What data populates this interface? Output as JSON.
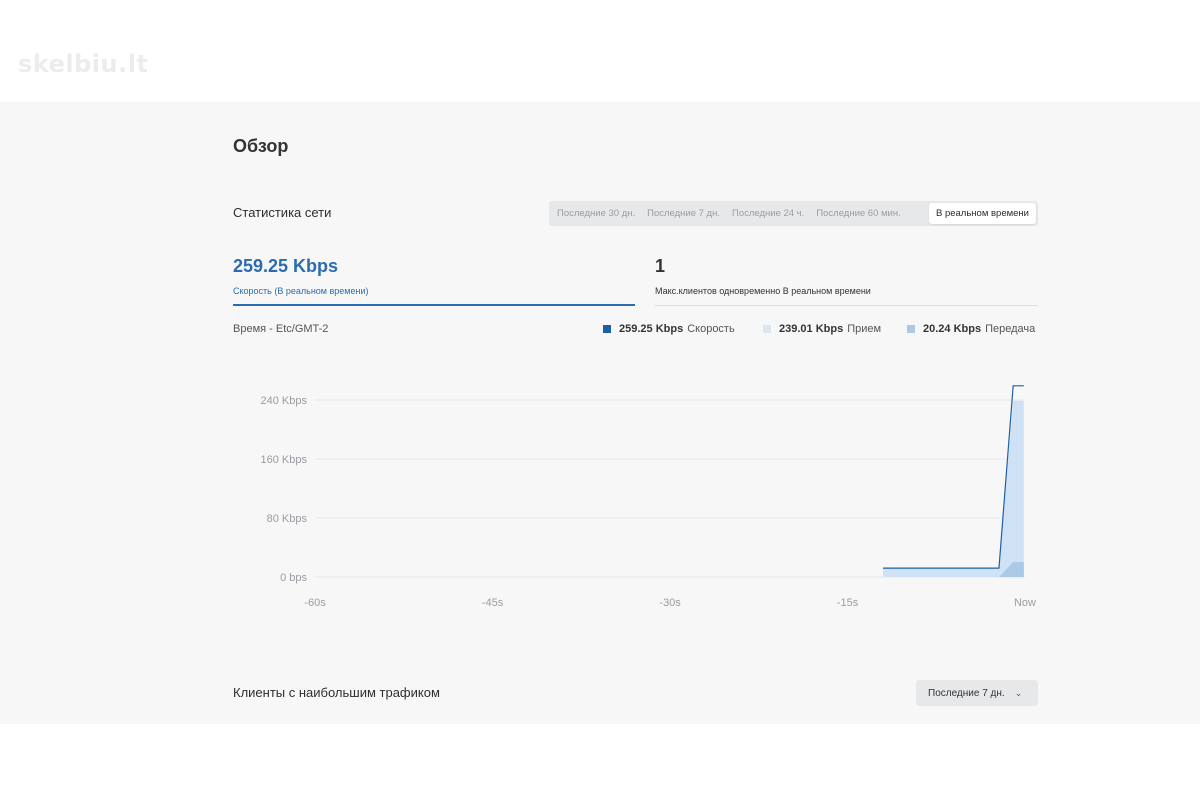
{
  "watermark": "skelbiu.lt",
  "page_title": "Обзор",
  "network": {
    "title": "Статистика сети",
    "ranges": [
      "Последние 30 дн.",
      "Последние 7 дн.",
      "Последние 24 ч.",
      "Последние 60 мин."
    ],
    "active_range": "В реальном времени",
    "speed_value": "259.25 Kbps",
    "speed_label": "Скорость (В реальном времени)",
    "clients_value": "1",
    "clients_label": "Макс.клиентов одновременно В реальном времени"
  },
  "chart_header": {
    "timezone": "Время - Etc/GMT-2",
    "legend": [
      {
        "value": "259.25 Kbps",
        "name": "Скорость",
        "color": "#1f5fa3"
      },
      {
        "value": "239.01 Kbps",
        "name": "Прием",
        "color": "#dbe6f1"
      },
      {
        "value": "20.24 Kbps",
        "name": "Передача",
        "color": "#a9c9e6"
      }
    ]
  },
  "chart_data": {
    "type": "area",
    "x": [
      -12,
      -10,
      -8,
      -6,
      -4,
      -2.2,
      -1.0,
      -0.1
    ],
    "x_ticks": [
      "-60s",
      "-45s",
      "-30s",
      "-15s",
      "Now"
    ],
    "x_range": [
      -60,
      0
    ],
    "y_ticks": [
      "0 bps",
      "80 Kbps",
      "160 Kbps",
      "240 Kbps"
    ],
    "y_range": [
      0,
      260
    ],
    "series": [
      {
        "name": "Скорость",
        "color": "#1f5fa3",
        "values": [
          12,
          12,
          12,
          12,
          12,
          12,
          259.25,
          259.25
        ]
      },
      {
        "name": "Прием",
        "color": "#cfe2f5",
        "values": [
          12,
          12,
          12,
          12,
          12,
          12,
          239.01,
          239.01
        ]
      },
      {
        "name": "Передача",
        "color": "#a9c9e6",
        "values": [
          0,
          0,
          0,
          0,
          0,
          0,
          20.24,
          20.24
        ]
      }
    ]
  },
  "top_clients": {
    "title": "Клиенты с наибольшим трафиком",
    "range": "Последние 7 дн."
  }
}
